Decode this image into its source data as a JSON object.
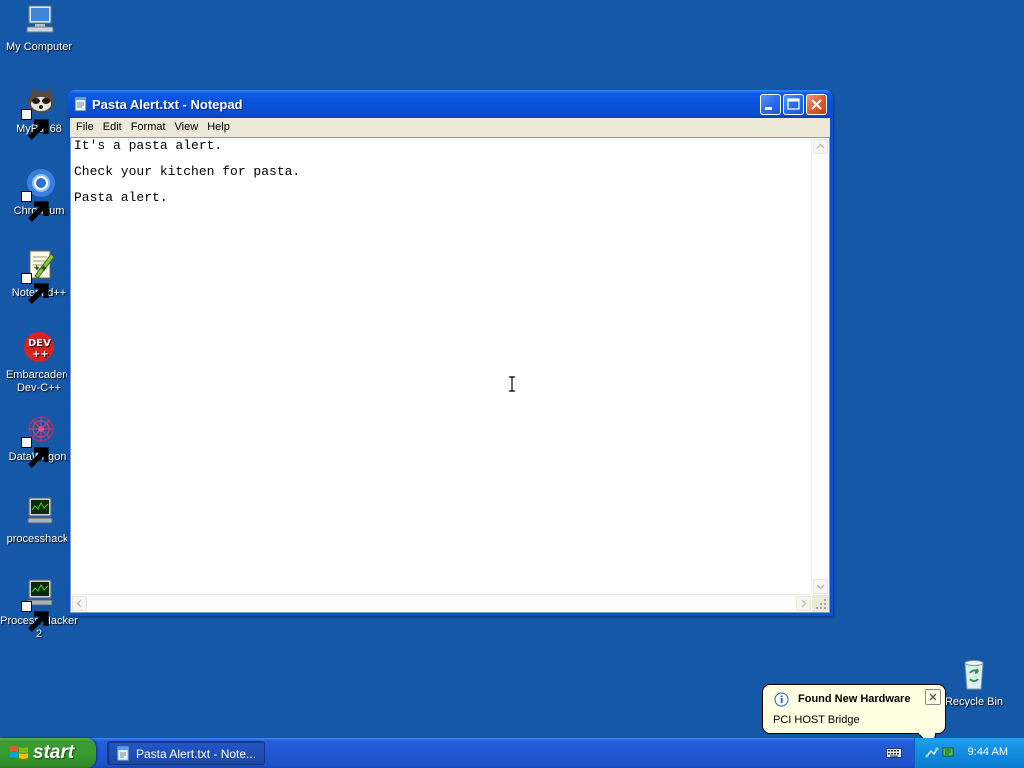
{
  "desktop": {
    "icons": [
      {
        "label": "My Computer",
        "icon": "my-computer-icon"
      },
      {
        "label": "MyPal 68",
        "icon": "mypal-icon"
      },
      {
        "label": "Chromium",
        "icon": "chromium-icon"
      },
      {
        "label": "Notepad++",
        "icon": "notepadpp-icon"
      },
      {
        "label": "Embarcadero Dev-C++",
        "label_line1": "Embarcadero",
        "label_line2": "Dev-C++",
        "icon": "devcpp-icon"
      },
      {
        "label": "DataWagon.",
        "icon": "datawagon-icon"
      },
      {
        "label": "processhack.",
        "icon": "processhacker-icon"
      },
      {
        "label": "Process Hacker 2",
        "label_line1": "Process Hacker",
        "label_line2": "2",
        "icon": "processhacker2-icon"
      },
      {
        "label": "Recycle Bin",
        "icon": "recycle-bin-icon"
      }
    ]
  },
  "window": {
    "title": "Pasta Alert.txt - Notepad",
    "menu": [
      "File",
      "Edit",
      "Format",
      "View",
      "Help"
    ],
    "content_lines": [
      "It's a pasta alert.",
      "Check your kitchen for pasta.",
      "Pasta alert."
    ]
  },
  "taskbar": {
    "start_label": "start",
    "task_label": "Pasta Alert.txt - Note...",
    "clock": "9:44 AM"
  },
  "balloon": {
    "title": "Found New Hardware",
    "body": "PCI HOST Bridge"
  },
  "colors": {
    "desktop_bg": "#1658a8",
    "titlebar_blue": "#0852d9",
    "start_green": "#379c2f",
    "tray_blue": "#0f8be0",
    "balloon_bg": "#ffffe1"
  }
}
